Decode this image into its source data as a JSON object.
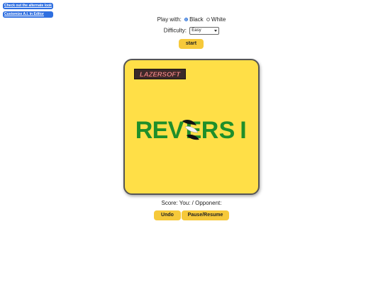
{
  "links": {
    "alternate_look": "Check out the alternate look",
    "customize_ai": "Customize A.I. in Editor"
  },
  "play_with": {
    "label": "Play with:",
    "options": [
      "Black",
      "White"
    ],
    "selected": "Black"
  },
  "difficulty": {
    "label": "Difficulty:",
    "selected": "Easy"
  },
  "buttons": {
    "start": "start",
    "undo": "Undo",
    "pause_resume": "Pause/Resume"
  },
  "board": {
    "brand_logo_text": "LAZERSOFT",
    "title_text": "REVERSI",
    "title_letters": [
      "R",
      "E",
      "V",
      "E",
      "R",
      "S",
      "I"
    ],
    "colors": {
      "board_bg": "#ffdf47",
      "title_green": "#1f8f2a",
      "logo_bg": "#3b2a2a",
      "logo_text": "#e9a6a6"
    }
  },
  "score": {
    "text": "Score: You: / Opponent:"
  },
  "colors": {
    "link_bg": "#2f6fe0",
    "button_bg": "#f6c93a"
  }
}
